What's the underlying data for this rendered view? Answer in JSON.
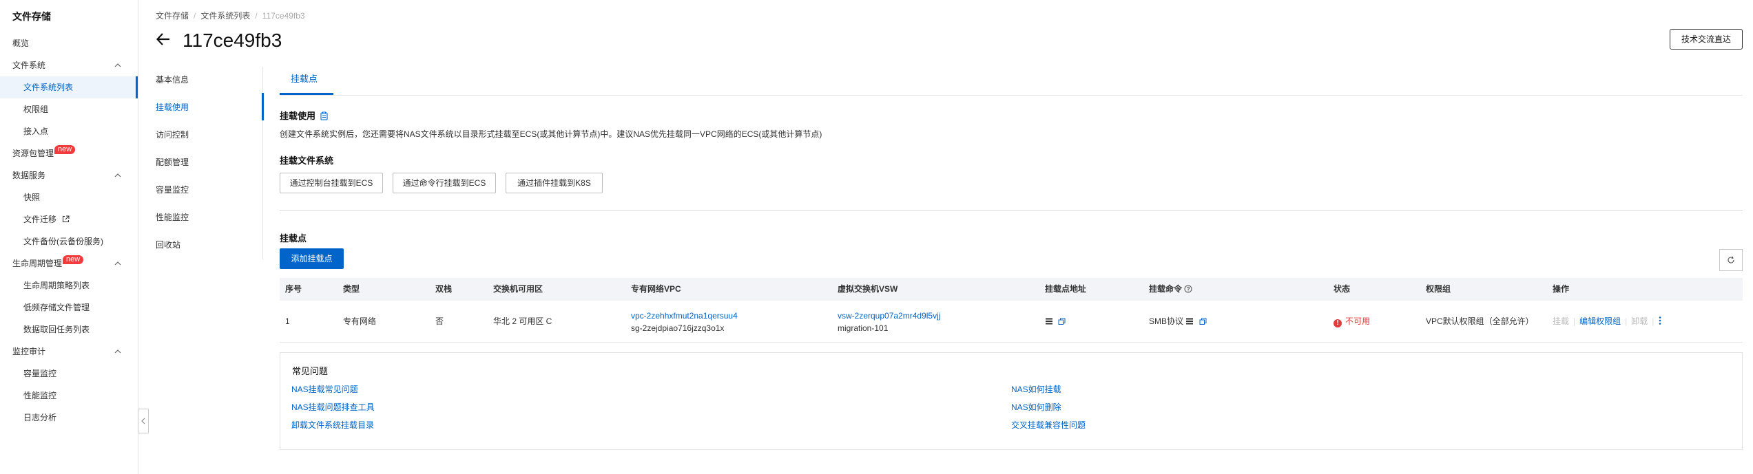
{
  "sidebar": {
    "title": "文件存储",
    "items": [
      {
        "label": "概览"
      },
      {
        "label": "文件系统"
      },
      {
        "label": "文件系统列表"
      },
      {
        "label": "权限组"
      },
      {
        "label": "接入点"
      },
      {
        "label": "资源包管理",
        "badge": "new"
      },
      {
        "label": "数据服务"
      },
      {
        "label": "快照"
      },
      {
        "label": "文件迁移"
      },
      {
        "label": "文件备份(云备份服务)"
      },
      {
        "label": "生命周期管理",
        "badge": "new"
      },
      {
        "label": "生命周期策略列表"
      },
      {
        "label": "低频存储文件管理"
      },
      {
        "label": "数据取回任务列表"
      },
      {
        "label": "监控审计"
      },
      {
        "label": "容量监控"
      },
      {
        "label": "性能监控"
      },
      {
        "label": "日志分析"
      }
    ]
  },
  "header": {
    "breadcrumb": [
      "文件存储",
      "文件系统列表",
      "117ce49fb3"
    ],
    "title": "117ce49fb3",
    "tech_button": "技术交流直达"
  },
  "subnav": [
    "基本信息",
    "挂载使用",
    "访问控制",
    "配额管理",
    "容量监控",
    "性能监控",
    "回收站"
  ],
  "tab": {
    "label": "挂载点"
  },
  "mount_usage": {
    "title": "挂载使用",
    "description": "创建文件系统实例后，您还需要将NAS文件系统以目录形式挂载至ECS(或其他计算节点)中。建议NAS优先挂载同一VPC网络的ECS(或其他计算节点)"
  },
  "mount_fs": {
    "title": "挂载文件系统",
    "buttons": [
      "通过控制台挂载到ECS",
      "通过命令行挂载到ECS",
      "通过插件挂载到K8S"
    ]
  },
  "mount_points": {
    "title": "挂载点",
    "add_button": "添加挂载点",
    "columns": [
      "序号",
      "类型",
      "双栈",
      "交换机可用区",
      "专有网络VPC",
      "虚拟交换机VSW",
      "挂载点地址",
      "挂载命令",
      "状态",
      "权限组",
      "操作"
    ],
    "rows": [
      {
        "index": "1",
        "type": "专有网络",
        "dual_stack": "否",
        "zone": "华北 2 可用区 C",
        "vpc_id": "vpc-2zehhxfmut2na1qersuu4",
        "vpc_name": "sg-2zejdpiao716jzzq3o1x",
        "vsw_id": "vsw-2zerqup07a2mr4d9l5vjj",
        "vsw_name": "migration-101",
        "mount_command": "SMB协议",
        "status": "不可用",
        "permission_group": "VPC默认权限组（全部允许）",
        "actions": [
          "挂载",
          "编辑权限组",
          "卸载"
        ]
      }
    ]
  },
  "faq": {
    "title": "常见问题",
    "left": [
      "NAS挂载常见问题",
      "NAS挂载问题排查工具",
      "卸载文件系统挂载目录"
    ],
    "right": [
      "NAS如何挂载",
      "NAS如何删除",
      "交叉挂载兼容性问题"
    ]
  },
  "colors": {
    "accent": "#0064c8",
    "error": "#e33b3b",
    "badge": "#f23c3c"
  }
}
